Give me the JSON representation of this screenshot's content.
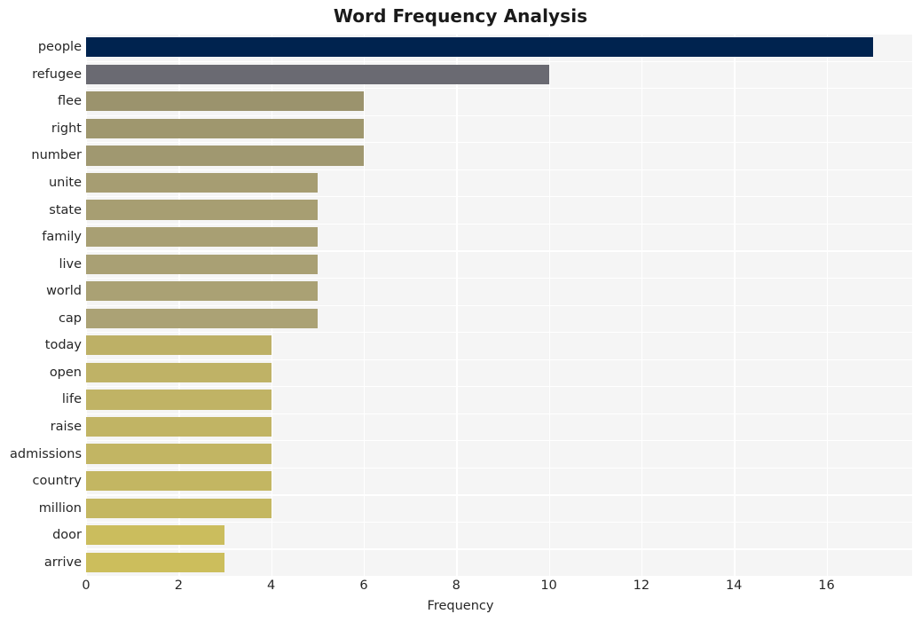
{
  "chart_data": {
    "type": "bar",
    "orientation": "horizontal",
    "title": "Word Frequency Analysis",
    "xlabel": "Frequency",
    "ylabel": "",
    "categories": [
      "people",
      "refugee",
      "flee",
      "right",
      "number",
      "unite",
      "state",
      "family",
      "live",
      "world",
      "cap",
      "today",
      "open",
      "life",
      "raise",
      "admissions",
      "country",
      "million",
      "door",
      "arrive"
    ],
    "values": [
      17,
      10,
      6,
      6,
      6,
      5,
      5,
      5,
      5,
      5,
      5,
      4,
      4,
      4,
      4,
      4,
      4,
      4,
      3,
      3
    ],
    "bar_colors": [
      "#00234f",
      "#6a6a72",
      "#9b936d",
      "#9f976e",
      "#a09870",
      "#a69d72",
      "#a79e72",
      "#a89f73",
      "#a9a074",
      "#aaa174",
      "#aba275",
      "#bdb066",
      "#bfb266",
      "#c0b365",
      "#c1b464",
      "#c2b563",
      "#c3b662",
      "#c4b761",
      "#cbbd5d",
      "#ccbe5c"
    ],
    "xlim": [
      0,
      17.85
    ],
    "xticks": [
      "0",
      "2",
      "4",
      "6",
      "8",
      "10",
      "12",
      "14",
      "16"
    ],
    "xtick_values": [
      0,
      2,
      4,
      6,
      8,
      10,
      12,
      14,
      16
    ],
    "grid": true,
    "grid_color": "#ffffff",
    "plot_background": "#f5f5f5",
    "figure_background": "#ffffff",
    "legend": null,
    "title_color": "#1a1a1a",
    "tick_color": "#262626"
  }
}
